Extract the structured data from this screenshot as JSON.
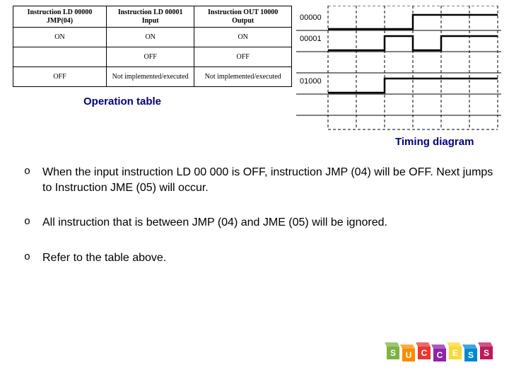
{
  "table": {
    "headers": [
      "Instruction LD 00000 JMP(04)",
      "Instruction LD 00001 Input",
      "Instruction OUT 10000 Output"
    ],
    "rows": [
      [
        "ON",
        "ON",
        "ON"
      ],
      [
        "",
        "OFF",
        "OFF"
      ],
      [
        "OFF",
        "Not implemented/executed",
        "Not implemented/executed"
      ]
    ],
    "caption": "Operation table"
  },
  "timing": {
    "signals": [
      "00000",
      "00001",
      "01000"
    ],
    "caption": "Timing diagram"
  },
  "bullets": [
    "When the input instruction LD 00 000 is OFF, instruction JMP (04) will be OFF. Next jumps to Instruction JME (05) will occur.",
    "All instruction that is between JMP (04) and JME (05) will be ignored.",
    "Refer to the table above."
  ],
  "blocks": {
    "letters": [
      "S",
      "U",
      "C",
      "C",
      "E",
      "S",
      "S"
    ],
    "colors": [
      "#7cb342",
      "#fb8c00",
      "#e53935",
      "#8e24aa",
      "#fdd835",
      "#0288d1",
      "#c2185b"
    ]
  },
  "chart_data": {
    "type": "timing",
    "time_divisions": 6,
    "signals": [
      {
        "name": "00000",
        "transitions": [
          0,
          0,
          0,
          1,
          1,
          1
        ]
      },
      {
        "name": "00001",
        "transitions": [
          0,
          0,
          1,
          0,
          1,
          1
        ]
      },
      {
        "name": "01000",
        "transitions": [
          0,
          0,
          1,
          1,
          1,
          1
        ]
      }
    ],
    "title": "Timing diagram"
  }
}
